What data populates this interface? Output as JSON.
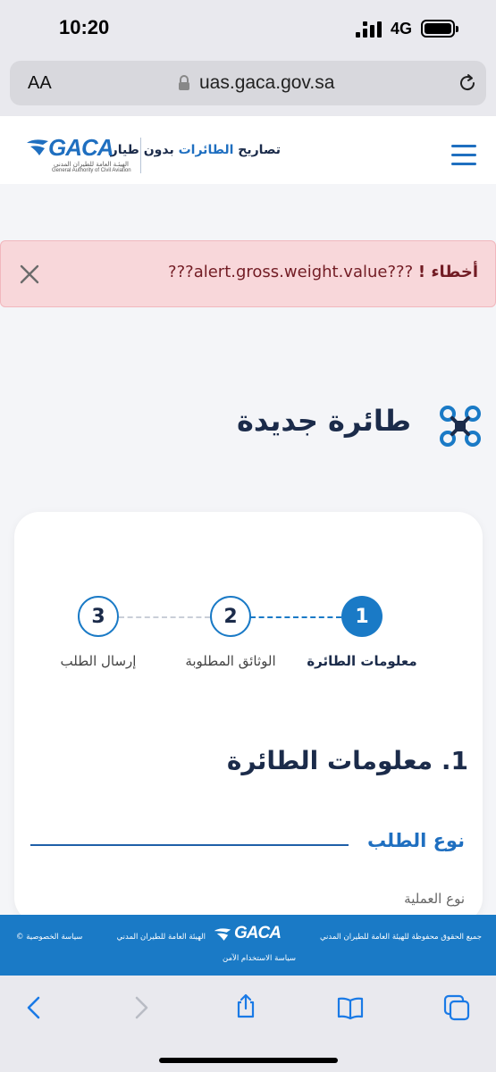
{
  "status_bar": {
    "time": "10:20",
    "network": "4G"
  },
  "browser": {
    "text_size_label": "AA",
    "domain": "uas.gaca.gov.sa"
  },
  "header": {
    "title_part1": "تصاريح ",
    "title_highlight": "الطائرات",
    "title_part2": " بدون طيار",
    "logo_word": "GACA",
    "logo_arabic": "الهيئـة العامة للطيران المدني",
    "logo_english": "General Authority of Civil Aviation"
  },
  "alert": {
    "label": "أخطاء !",
    "message": "???alert.gross.weight.value???"
  },
  "page": {
    "title": "طائرة جديدة"
  },
  "stepper": {
    "steps": [
      {
        "number": "1",
        "label": "معلومات الطائرة",
        "state": "active"
      },
      {
        "number": "2",
        "label": "الوثائق المطلوبة",
        "state": "idle"
      },
      {
        "number": "3",
        "label": "إرسال الطلب",
        "state": "idle"
      }
    ]
  },
  "form": {
    "section_title": "1. معلومات الطائرة",
    "subsection_title": "نوع الطلب",
    "field_label": "نوع العملية"
  },
  "footer": {
    "copyright": "جميع الحقوق محفوظة للهيئة العامة للطيران المدني",
    "org_name": "الهيئة العامة للطيران المدني",
    "privacy": "سياسة الخصوصية ©",
    "usage_policy": "سياسة الاستخدام الآمن",
    "logo_word": "GACA"
  },
  "colors": {
    "brand_blue": "#1a7ac6",
    "navy": "#1b2b4a",
    "alert_bg": "#f8d7da",
    "alert_text": "#721c24"
  }
}
